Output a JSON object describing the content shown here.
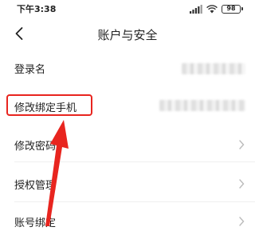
{
  "status_bar": {
    "time": "下午3:38",
    "battery_level": "98",
    "icons": [
      "signal-icon",
      "wifi-icon",
      "battery-icon"
    ]
  },
  "nav": {
    "title": "账户与安全",
    "back_icon": "chevron-left-icon"
  },
  "rows": [
    {
      "label": "登录名",
      "value_blurred": true,
      "has_chevron": false
    },
    {
      "label": "修改绑定手机",
      "value_blurred": true,
      "has_chevron": false
    },
    {
      "label": "修改密码",
      "value_blurred": false,
      "has_chevron": true
    },
    {
      "label": "授权管理",
      "value_blurred": false,
      "has_chevron": true
    },
    {
      "label": "账号绑定",
      "value_blurred": false,
      "has_chevron": true
    }
  ],
  "annotation": {
    "highlight_color": "#e8251f",
    "target": "修改绑定手机"
  },
  "colors": {
    "text": "#222222",
    "chevron": "#bbbbbb",
    "divider": "#efefef",
    "annotation_red": "#e8251f"
  }
}
